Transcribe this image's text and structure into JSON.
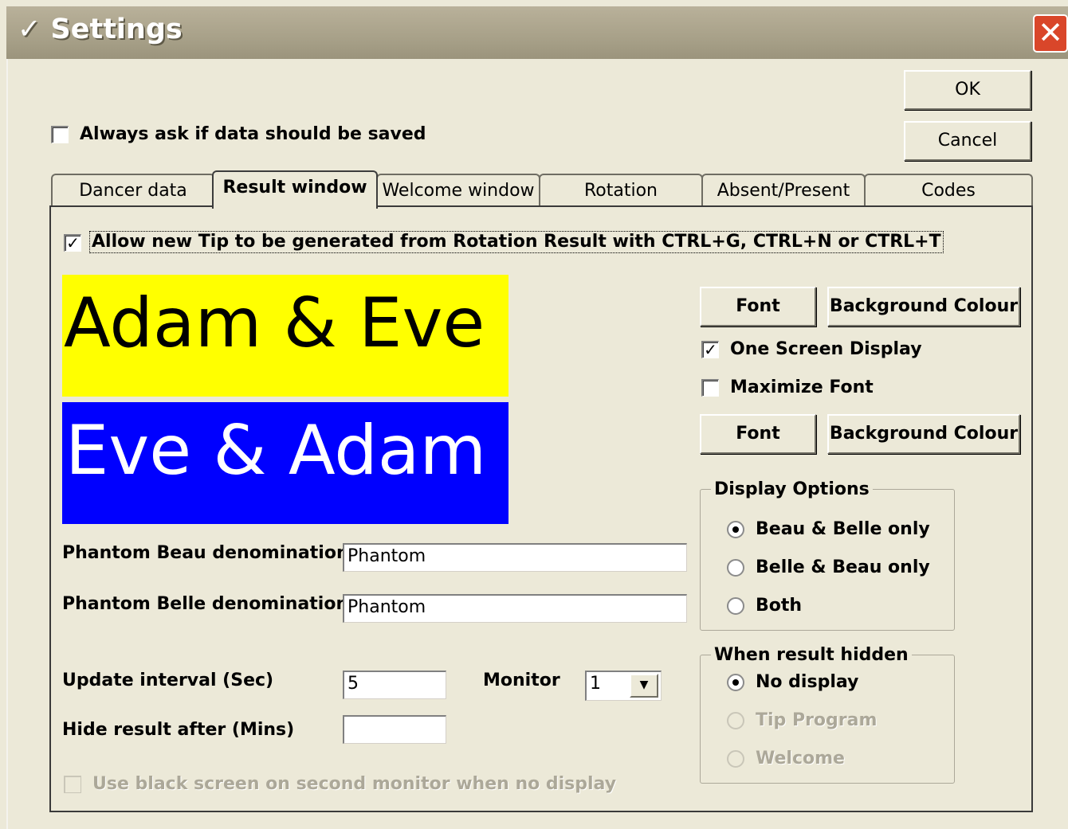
{
  "window": {
    "title": "Settings",
    "check_glyph": "✓",
    "close_glyph": "✕"
  },
  "buttons": {
    "ok": "OK",
    "cancel": "Cancel"
  },
  "always_ask": {
    "label": "Always ask if data should be saved",
    "checked": false
  },
  "tabs": [
    {
      "label": "Dancer data",
      "active": false
    },
    {
      "label": "Result window",
      "active": true
    },
    {
      "label": "Welcome window",
      "active": false
    },
    {
      "label": "Rotation",
      "active": false
    },
    {
      "label": "Absent/Present",
      "active": false
    },
    {
      "label": "Codes",
      "active": false
    }
  ],
  "result": {
    "allow_new_tip": {
      "label": "Allow new Tip to be generated from Rotation Result with CTRL+G, CTRL+N or CTRL+T",
      "checked": true
    },
    "preview_top": {
      "text": "Adam & Eve",
      "background": "#ffff00",
      "color": "#000000"
    },
    "preview_bottom": {
      "text": "Eve & Adam",
      "background": "#0000ff",
      "color": "#ffffff"
    },
    "font_button_1": "Font",
    "bg_button_1": "Background Colour",
    "one_screen": {
      "label": "One Screen Display",
      "checked": true
    },
    "maximize_font": {
      "label": "Maximize Font",
      "checked": false
    },
    "font_button_2": "Font",
    "bg_button_2": "Background Colour",
    "phantom_beau": {
      "label": "Phantom Beau denomination",
      "value": "Phantom"
    },
    "phantom_belle": {
      "label": "Phantom Belle denomination",
      "value": "Phantom"
    },
    "update_interval": {
      "label": "Update interval (Sec)",
      "value": "5"
    },
    "monitor": {
      "label": "Monitor",
      "value": "1"
    },
    "hide_result": {
      "label": "Hide result after (Mins)",
      "value": ""
    },
    "black_screen": {
      "label": "Use black screen on second monitor when no display",
      "checked": false,
      "enabled": false
    },
    "display_options": {
      "title": "Display Options",
      "options": [
        {
          "label": "Beau & Belle only",
          "selected": true
        },
        {
          "label": "Belle & Beau only",
          "selected": false
        },
        {
          "label": "Both",
          "selected": false
        }
      ]
    },
    "when_hidden": {
      "title": "When result hidden",
      "options": [
        {
          "label": "No display",
          "selected": true,
          "enabled": true
        },
        {
          "label": "Tip Program",
          "selected": false,
          "enabled": false
        },
        {
          "label": "Welcome",
          "selected": false,
          "enabled": false
        }
      ]
    }
  },
  "colors": {
    "titlebar": "#a59e86",
    "dialog": "#ece9d8",
    "close": "#d9462a"
  }
}
